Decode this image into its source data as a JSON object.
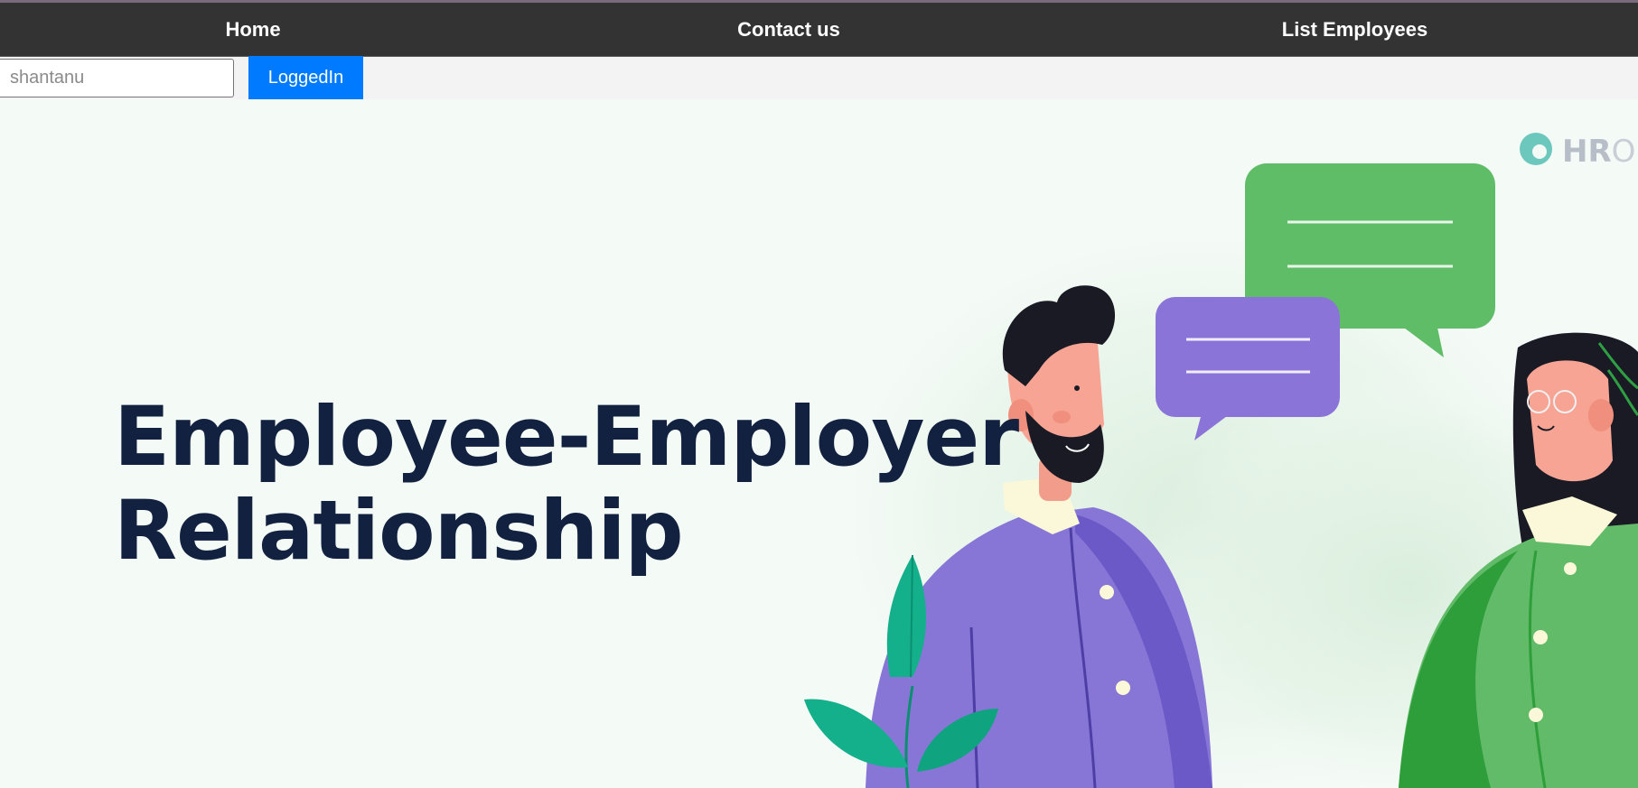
{
  "nav": {
    "items": [
      {
        "label": "Home"
      },
      {
        "label": "Contact us"
      },
      {
        "label": "List Employees"
      }
    ]
  },
  "login": {
    "username_value": "",
    "username_placeholder": "shantanu",
    "button_label": "LoggedIn"
  },
  "banner": {
    "headline_line1": "Employee-Employer",
    "headline_line2": "Relationship",
    "logo_text": "HR",
    "logo_text_tail": "O",
    "illustration_icon": "two-people-chatting-illustration"
  },
  "colors": {
    "nav_bg": "#333333",
    "button_bg": "#007bff",
    "banner_bg": "#f4faf6",
    "headline": "#11213f",
    "bubble_green": "#5fbd68",
    "bubble_purple": "#8b74d8",
    "shirt_purple": "#8776d6",
    "dress_green": "#62bb69"
  }
}
